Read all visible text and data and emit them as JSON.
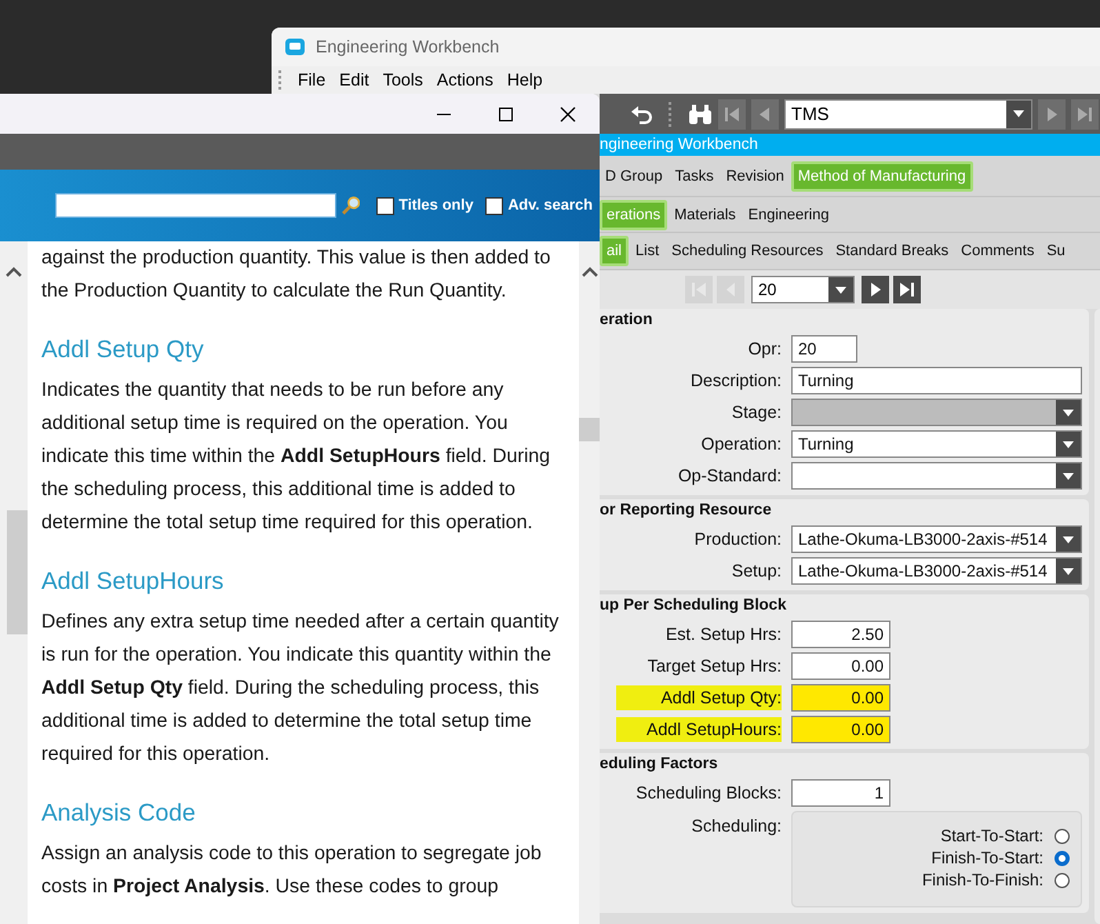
{
  "back_window": {
    "title": "Engineering Workbench",
    "menu": [
      "File",
      "Edit",
      "Tools",
      "Actions",
      "Help"
    ],
    "record_combo": "TMS",
    "banner": "ngineering Workbench",
    "tab_rows": [
      [
        {
          "label": "D Group",
          "selected": false
        },
        {
          "label": "Tasks",
          "selected": false
        },
        {
          "label": "Revision",
          "selected": false
        },
        {
          "label": "Method of Manufacturing",
          "selected": true
        }
      ],
      [
        {
          "label": "erations",
          "selected": true
        },
        {
          "label": "Materials",
          "selected": false
        },
        {
          "label": "Engineering",
          "selected": false
        }
      ],
      [
        {
          "label": "ail",
          "selected": true
        },
        {
          "label": "List",
          "selected": false
        },
        {
          "label": "Scheduling Resources",
          "selected": false
        },
        {
          "label": "Standard Breaks",
          "selected": false
        },
        {
          "label": "Comments",
          "selected": false
        },
        {
          "label": "Su",
          "selected": false
        }
      ]
    ],
    "navigator": {
      "value": "20"
    },
    "panels": [
      {
        "title": "eration",
        "fields": [
          {
            "kind": "code",
            "label": "Opr:",
            "value": "20",
            "disabled": false,
            "highlighted": false
          },
          {
            "kind": "text",
            "label": "Description:",
            "value": "Turning",
            "disabled": false,
            "highlighted": false
          },
          {
            "kind": "combo",
            "label": "Stage:",
            "disabled": true,
            "highlighted": false
          },
          {
            "kind": "combo",
            "label": "Operation:",
            "value": "Turning",
            "disabled": false,
            "highlighted": false
          },
          {
            "kind": "combo",
            "label": "Op-Standard:",
            "disabled": false,
            "highlighted": false
          }
        ]
      },
      {
        "title": "or Reporting Resource",
        "fields": [
          {
            "kind": "combo",
            "label": "Production:",
            "value": "Lathe-Okuma-LB3000-2axis-#514",
            "disabled": false,
            "highlighted": false
          },
          {
            "kind": "combo",
            "label": "Setup:",
            "value": "Lathe-Okuma-LB3000-2axis-#514",
            "disabled": false,
            "highlighted": false
          }
        ]
      },
      {
        "title": "up Per Scheduling Block",
        "fields": [
          {
            "kind": "number",
            "label": "Est. Setup Hrs:",
            "value": "2.50",
            "disabled": false,
            "highlighted": false
          },
          {
            "kind": "number",
            "label": "Target Setup Hrs:",
            "value": "0.00",
            "disabled": false,
            "highlighted": false
          },
          {
            "kind": "number",
            "label": "Addl Setup Qty:",
            "value": "0.00",
            "disabled": false,
            "highlighted": true
          },
          {
            "kind": "number",
            "label": "Addl SetupHours:",
            "value": "0.00",
            "disabled": false,
            "highlighted": true
          }
        ]
      },
      {
        "title": "eduling Factors",
        "fields": [
          {
            "kind": "number",
            "label": "Scheduling Blocks:",
            "value": "1",
            "disabled": false,
            "highlighted": false
          },
          {
            "kind": "radio-group",
            "label": "Scheduling:",
            "options": [
              {
                "label": "Start-To-Start:",
                "selected": false
              },
              {
                "label": "Finish-To-Start:",
                "selected": true
              },
              {
                "label": "Finish-To-Finish:",
                "selected": false
              }
            ]
          }
        ]
      }
    ]
  },
  "help_window": {
    "search_options": [
      {
        "label": "Titles only",
        "checked": false
      },
      {
        "label": "Adv. search",
        "checked": false
      }
    ],
    "content": [
      {
        "kind": "paragraph",
        "text": "against the production quantity. This value is then added to the Production Quantity to calculate the Run Quantity."
      },
      {
        "kind": "heading",
        "text": "Addl Setup Qty"
      },
      {
        "kind": "paragraph",
        "text": "Indicates the quantity that needs to be run before any additional setup time is required on the operation. You indicate this time within the **Addl SetupHours** field. During the scheduling process, this additional time is added to determine the total setup time required for this operation."
      },
      {
        "kind": "heading",
        "text": "Addl SetupHours"
      },
      {
        "kind": "paragraph",
        "text": "Defines any extra setup time needed after a certain quantity is run for the operation. You indicate this quantity within the **Addl Setup Qty** field. During the scheduling process, this additional time is added to determine the total setup time required for this operation."
      },
      {
        "kind": "heading",
        "text": "Analysis Code"
      },
      {
        "kind": "paragraph",
        "text": "Assign an analysis code to this operation to segregate job costs in **Project Analysis**. Use these codes to group"
      }
    ]
  }
}
